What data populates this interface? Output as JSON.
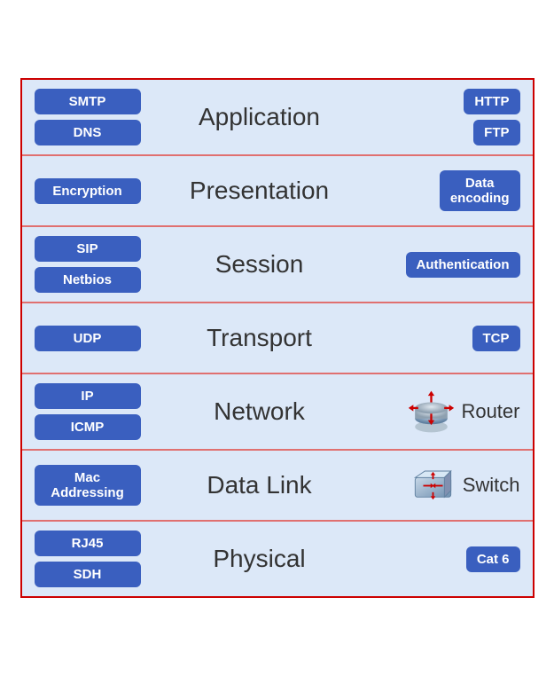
{
  "layers": [
    {
      "id": "application",
      "name": "Application",
      "left_badges": [
        "SMTP",
        "DNS"
      ],
      "right_badges": [
        "HTTP",
        "FTP"
      ],
      "right_icon": null,
      "right_label": null
    },
    {
      "id": "presentation",
      "name": "Presentation",
      "left_badges": [
        "Encryption"
      ],
      "right_badges": [
        "Data\nencoding"
      ],
      "right_icon": null,
      "right_label": null
    },
    {
      "id": "session",
      "name": "Session",
      "left_badges": [
        "SIP",
        "Netbios"
      ],
      "right_badges": [
        "Authentication"
      ],
      "right_icon": null,
      "right_label": null
    },
    {
      "id": "transport",
      "name": "Transport",
      "left_badges": [
        "UDP"
      ],
      "right_badges": [
        "TCP"
      ],
      "right_icon": null,
      "right_label": null
    },
    {
      "id": "network",
      "name": "Network",
      "left_badges": [
        "IP",
        "ICMP"
      ],
      "right_badges": [],
      "right_icon": "router",
      "right_label": "Router"
    },
    {
      "id": "datalink",
      "name": "Data Link",
      "left_badges": [
        "Mac\nAddressing"
      ],
      "right_badges": [],
      "right_icon": "switch",
      "right_label": "Switch"
    },
    {
      "id": "physical",
      "name": "Physical",
      "left_badges": [
        "RJ45",
        "SDH"
      ],
      "right_badges": [
        "Cat 6"
      ],
      "right_icon": null,
      "right_label": null
    }
  ]
}
